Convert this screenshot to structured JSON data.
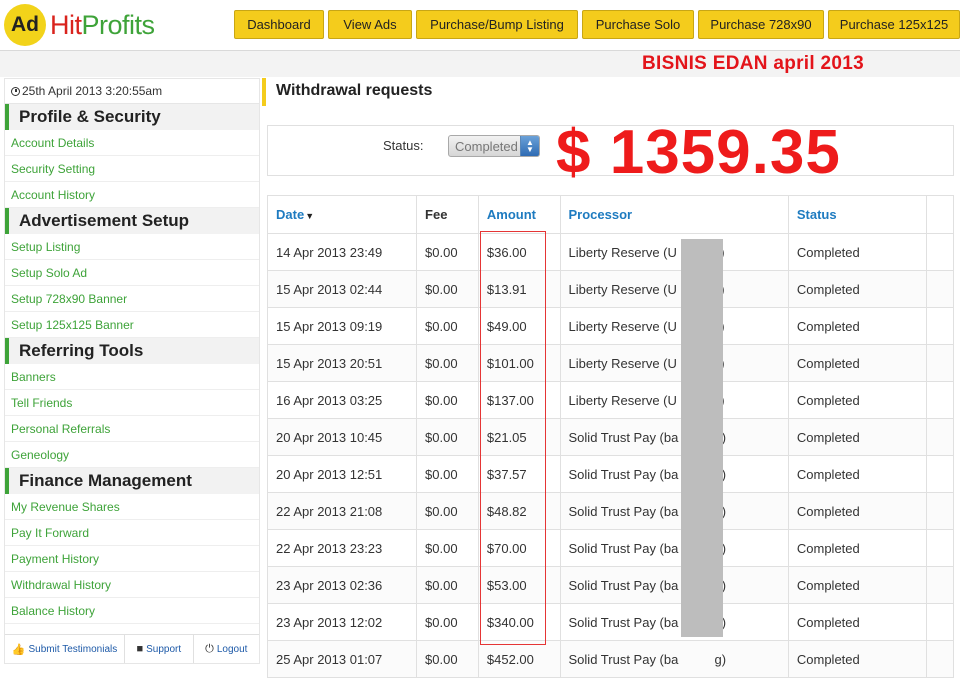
{
  "header": {
    "logo_ad": "Ad",
    "logo_hit": "Hit",
    "logo_profits": "Profits",
    "nav": [
      {
        "label": "Dashboard",
        "name": "nav-dashboard"
      },
      {
        "label": "View Ads",
        "name": "nav-view-ads"
      },
      {
        "label": "Purchase/Bump Listing",
        "name": "nav-purchase-bump-listing"
      },
      {
        "label": "Purchase Solo",
        "name": "nav-purchase-solo"
      },
      {
        "label": "Purchase 728x90",
        "name": "nav-purchase-728x90"
      },
      {
        "label": "Purchase 125x125",
        "name": "nav-purchase-125x125"
      }
    ],
    "banner_text": "BISNIS EDAN april 2013"
  },
  "sidebar": {
    "datetime": "25th April 2013 3:20:55am",
    "sections": [
      {
        "title": "Profile & Security",
        "items": [
          "Account Details",
          "Security Setting",
          "Account History"
        ]
      },
      {
        "title": "Advertisement Setup",
        "items": [
          "Setup Listing",
          "Setup Solo Ad",
          "Setup 728x90 Banner",
          "Setup 125x125 Banner"
        ]
      },
      {
        "title": "Referring Tools",
        "items": [
          "Banners",
          "Tell Friends",
          "Personal Referrals",
          "Geneology"
        ]
      },
      {
        "title": "Finance Management",
        "items": [
          "My Revenue Shares",
          "Pay It Forward",
          "Payment History",
          "Withdrawal History",
          "Balance History"
        ]
      }
    ],
    "footer": {
      "testimonials": "Submit Testimonials",
      "support": "Support",
      "logout": "Logout"
    }
  },
  "main": {
    "title": "Withdrawal requests",
    "status_label": "Status:",
    "status_value": "Completed",
    "total": "$ 1359.35",
    "columns": {
      "date": "Date",
      "fee": "Fee",
      "amount": "Amount",
      "processor": "Processor",
      "status": "Status"
    },
    "rows": [
      {
        "date": "14 Apr 2013 23:49",
        "fee": "$0.00",
        "amount": "$36.00",
        "processor": "Liberty Reserve (U          6)",
        "status": "Completed"
      },
      {
        "date": "15 Apr 2013 02:44",
        "fee": "$0.00",
        "amount": "$13.91",
        "processor": "Liberty Reserve (U          6)",
        "status": "Completed"
      },
      {
        "date": "15 Apr 2013 09:19",
        "fee": "$0.00",
        "amount": "$49.00",
        "processor": "Liberty Reserve (U          6)",
        "status": "Completed"
      },
      {
        "date": "15 Apr 2013 20:51",
        "fee": "$0.00",
        "amount": "$101.00",
        "processor": "Liberty Reserve (U          6)",
        "status": "Completed"
      },
      {
        "date": "16 Apr 2013 03:25",
        "fee": "$0.00",
        "amount": "$137.00",
        "processor": "Liberty Reserve (U          6)",
        "status": "Completed"
      },
      {
        "date": "20 Apr 2013 10:45",
        "fee": "$0.00",
        "amount": "$21.05",
        "processor": "Solid Trust Pay (ba          g)",
        "status": "Completed"
      },
      {
        "date": "20 Apr 2013 12:51",
        "fee": "$0.00",
        "amount": "$37.57",
        "processor": "Solid Trust Pay (ba          g)",
        "status": "Completed"
      },
      {
        "date": "22 Apr 2013 21:08",
        "fee": "$0.00",
        "amount": "$48.82",
        "processor": "Solid Trust Pay (ba          g)",
        "status": "Completed"
      },
      {
        "date": "22 Apr 2013 23:23",
        "fee": "$0.00",
        "amount": "$70.00",
        "processor": "Solid Trust Pay (ba          g)",
        "status": "Completed"
      },
      {
        "date": "23 Apr 2013 02:36",
        "fee": "$0.00",
        "amount": "$53.00",
        "processor": "Solid Trust Pay (ba          g)",
        "status": "Completed"
      },
      {
        "date": "23 Apr 2013 12:02",
        "fee": "$0.00",
        "amount": "$340.00",
        "processor": "Solid Trust Pay (ba          g)",
        "status": "Completed"
      },
      {
        "date": "25 Apr 2013 01:07",
        "fee": "$0.00",
        "amount": "$452.00",
        "processor": "Solid Trust Pay (ba          g)",
        "status": "Completed"
      }
    ]
  },
  "colors": {
    "accent_yellow": "#f4cc1c",
    "accent_green": "#3ea339",
    "brand_red": "#d9231d",
    "highlight_red": "#ee1b1b",
    "link_blue": "#1e7bc0"
  }
}
